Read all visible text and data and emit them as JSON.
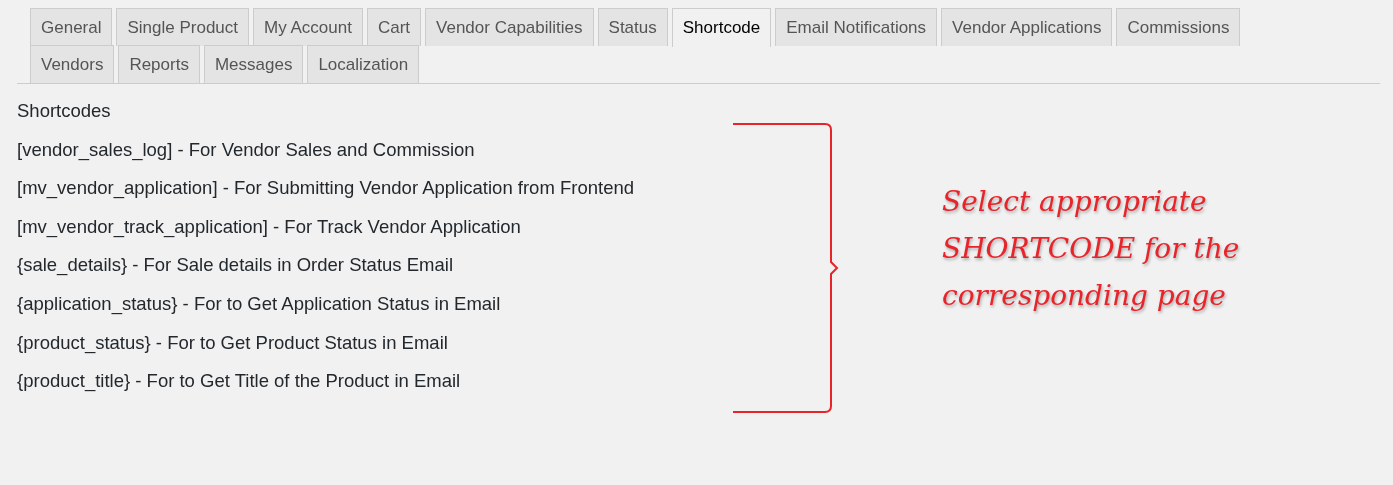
{
  "tab_rows": [
    [
      {
        "label": "General",
        "selected": false
      },
      {
        "label": "Single Product",
        "selected": false
      },
      {
        "label": "My Account",
        "selected": false
      },
      {
        "label": "Cart",
        "selected": false
      },
      {
        "label": "Vendor Capabilities",
        "selected": false
      },
      {
        "label": "Status",
        "selected": false
      },
      {
        "label": "Shortcode",
        "selected": true
      },
      {
        "label": "Email Notifications",
        "selected": false
      },
      {
        "label": "Vendor Applications",
        "selected": false
      },
      {
        "label": "Commissions",
        "selected": false
      }
    ],
    [
      {
        "label": "Vendors",
        "selected": false
      },
      {
        "label": "Reports",
        "selected": false
      },
      {
        "label": "Messages",
        "selected": false
      },
      {
        "label": "Localization",
        "selected": false
      }
    ]
  ],
  "section_title": "Shortcodes",
  "shortcodes": [
    "[vendor_sales_log] - For Vendor Sales and Commission",
    "[mv_vendor_application] - For Submitting Vendor Application from Frontend",
    "[mv_vendor_track_application] - For Track Vendor Application",
    "{sale_details} - For Sale details in Order Status Email",
    "{application_status} - For to Get Application Status in Email",
    "{product_status} - For to Get Product Status in Email",
    "{product_title} - For to Get Title of the Product in Email"
  ],
  "annotation": {
    "lines": [
      "Select appropriate",
      "SHORTCODE for the",
      "corresponding page"
    ]
  }
}
